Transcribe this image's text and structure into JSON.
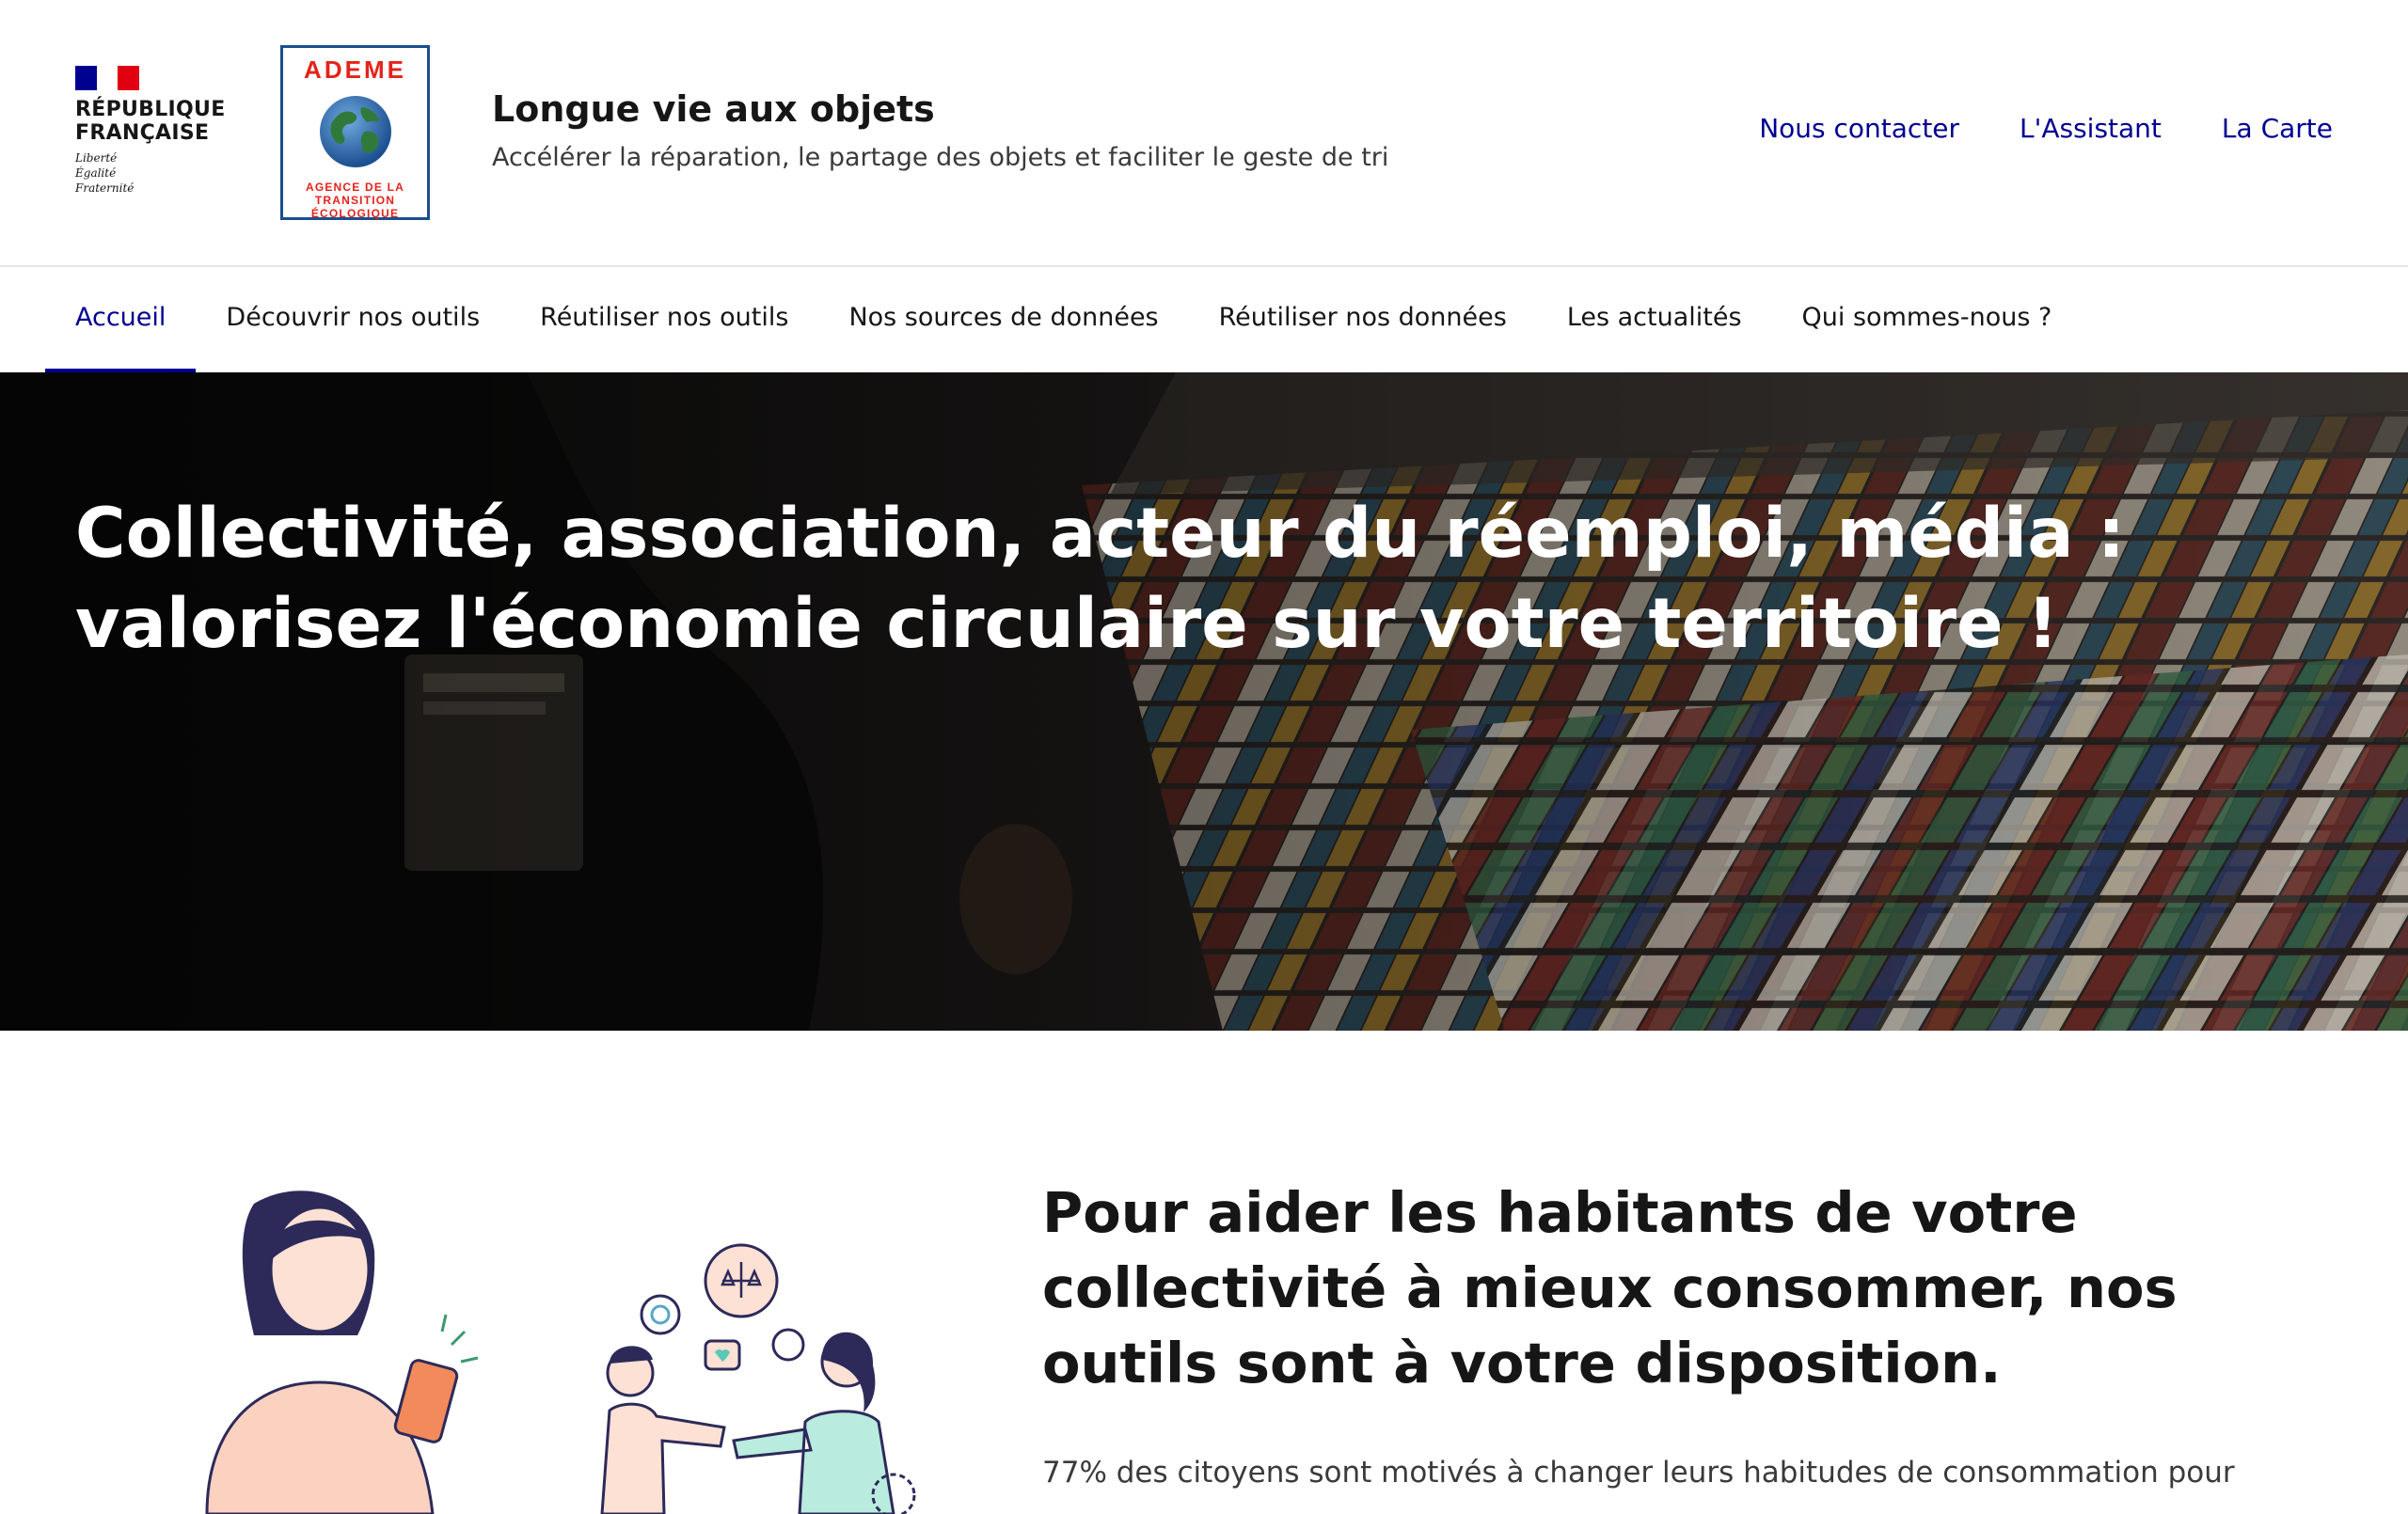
{
  "header": {
    "republique": {
      "label": "RÉPUBLIQUE\nFRANÇAISE",
      "motto": "Liberté\nÉgalité\nFraternité"
    },
    "ademe": {
      "name": "ADEME",
      "agency": "AGENCE DE LA\nTRANSITION\nÉCOLOGIQUE"
    },
    "title": "Longue vie aux objets",
    "tagline": "Accélérer la réparation, le partage des objets et faciliter le geste de tri",
    "tools": [
      {
        "label": "Nous contacter"
      },
      {
        "label": "L'Assistant"
      },
      {
        "label": "La Carte"
      }
    ]
  },
  "nav": {
    "items": [
      {
        "label": "Accueil",
        "active": true
      },
      {
        "label": "Découvrir nos outils"
      },
      {
        "label": "Réutiliser nos outils"
      },
      {
        "label": "Nos sources de données"
      },
      {
        "label": "Réutiliser nos données"
      },
      {
        "label": "Les actualités"
      },
      {
        "label": "Qui sommes-nous ?"
      }
    ]
  },
  "hero": {
    "title": "Collectivité, association, acteur du réemploi, média : valorisez l'économie circulaire sur votre territoire !"
  },
  "intro": {
    "title": "Pour aider les habitants de votre collectivité à mieux consommer, nos outils sont à votre disposition.",
    "text": "77% des citoyens sont motivés à changer leurs habitudes de consommation pour"
  },
  "colors": {
    "primary": "#000091",
    "text": "#161616",
    "ademe_red": "#e3231b",
    "ademe_blue": "#1a4f8f"
  }
}
